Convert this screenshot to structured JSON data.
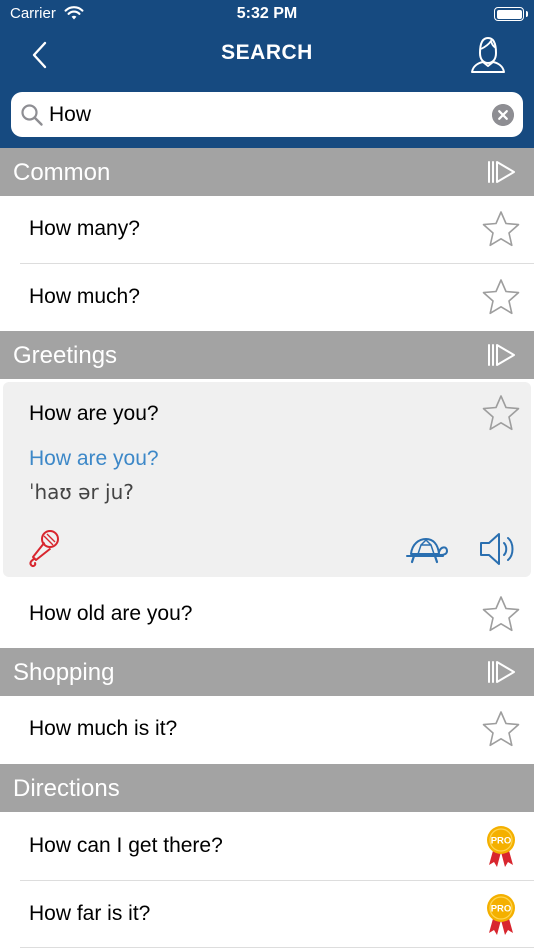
{
  "status_bar": {
    "carrier": "Carrier",
    "time": "5:32 PM"
  },
  "nav": {
    "title": "SEARCH",
    "back_icon": "chevron-left-icon",
    "user_icon": "user-icon"
  },
  "search": {
    "value": "How",
    "placeholder": ""
  },
  "colors": {
    "header": "#164a80",
    "section": "#a3a3a3",
    "translation": "#3d88c8",
    "mic": "#d8262e",
    "pro_badge": "#f4b000",
    "pro_ribbon": "#d8262e"
  },
  "sections": [
    {
      "title": "Common",
      "rows": [
        "How many?",
        "How much?"
      ]
    },
    {
      "title": "Greetings",
      "expanded": {
        "phrase": "How are you?",
        "translation": "How are you?",
        "ipa": "ˈhaʊ ər ju?"
      },
      "rows": [
        "How old are you?"
      ]
    },
    {
      "title": "Shopping",
      "rows": [
        "How much is it?"
      ]
    },
    {
      "title": "Directions",
      "rows": [
        "How can I get there?",
        "How far is it?"
      ],
      "badge": "PRO"
    }
  ]
}
